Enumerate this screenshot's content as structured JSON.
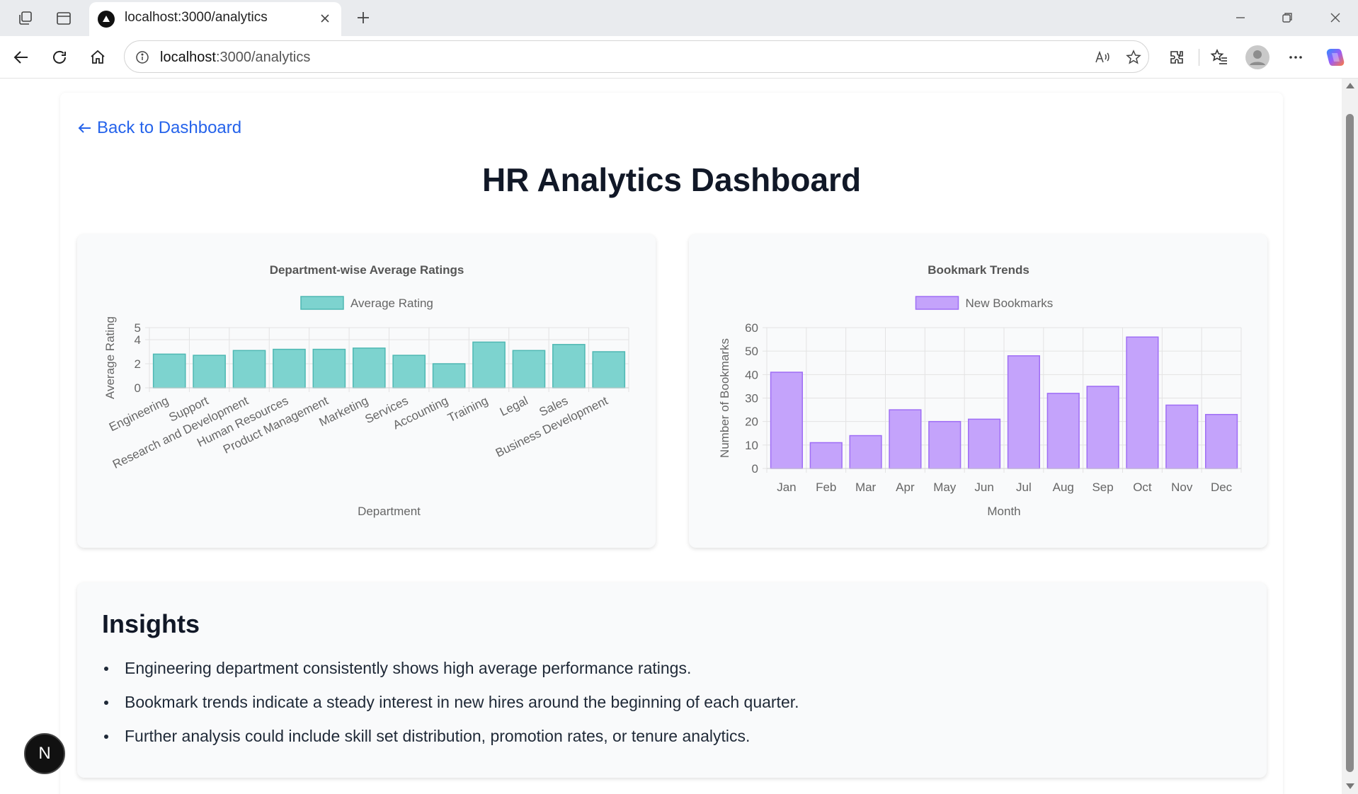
{
  "browser": {
    "tab_title": "localhost:3000/analytics",
    "url_host": "localhost",
    "url_path": ":3000/analytics"
  },
  "page": {
    "back_label": "Back to Dashboard",
    "title": "HR Analytics Dashboard"
  },
  "charts": {
    "ratings": {
      "type": "bar",
      "title": "Department-wise Average Ratings",
      "legend": "Average Rating",
      "xlabel": "Department",
      "ylabel": "Average Rating",
      "ylim": [
        0,
        5
      ],
      "yticks": [
        0,
        2,
        4,
        5
      ],
      "color": "#7dd3cf",
      "border": "#4fb8b3",
      "categories": [
        "Engineering",
        "Support",
        "Research and Development",
        "Human Resources",
        "Product Management",
        "Marketing",
        "Services",
        "Accounting",
        "Training",
        "Legal",
        "Sales",
        "Business Development"
      ],
      "values": [
        2.8,
        2.7,
        3.1,
        3.2,
        3.2,
        3.3,
        2.7,
        2.0,
        3.8,
        3.1,
        3.6,
        3.0
      ]
    },
    "bookmarks": {
      "type": "bar",
      "title": "Bookmark Trends",
      "legend": "New Bookmarks",
      "xlabel": "Month",
      "ylabel": "Number of Bookmarks",
      "ylim": [
        0,
        60
      ],
      "yticks": [
        0,
        10,
        20,
        30,
        40,
        50,
        60
      ],
      "color": "#c4a3fb",
      "border": "#9f6ef5",
      "categories": [
        "Jan",
        "Feb",
        "Mar",
        "Apr",
        "May",
        "Jun",
        "Jul",
        "Aug",
        "Sep",
        "Oct",
        "Nov",
        "Dec"
      ],
      "values": [
        41,
        11,
        14,
        25,
        20,
        21,
        48,
        32,
        35,
        56,
        27,
        23
      ]
    }
  },
  "insights": {
    "title": "Insights",
    "items": [
      "Engineering department consistently shows high average performance ratings.",
      "Bookmark trends indicate a steady interest in new hires around the beginning of each quarter.",
      "Further analysis could include skill set distribution, promotion rates, or tenure analytics."
    ]
  },
  "next_badge": "N",
  "chart_data": [
    {
      "type": "bar",
      "title": "Department-wise Average Ratings",
      "xlabel": "Department",
      "ylabel": "Average Rating",
      "ylim": [
        0,
        5
      ],
      "categories": [
        "Engineering",
        "Support",
        "Research and Development",
        "Human Resources",
        "Product Management",
        "Marketing",
        "Services",
        "Accounting",
        "Training",
        "Legal",
        "Sales",
        "Business Development"
      ],
      "series": [
        {
          "name": "Average Rating",
          "values": [
            2.8,
            2.7,
            3.1,
            3.2,
            3.2,
            3.3,
            2.7,
            2.0,
            3.8,
            3.1,
            3.6,
            3.0
          ]
        }
      ],
      "grid": true,
      "legend_position": "top"
    },
    {
      "type": "bar",
      "title": "Bookmark Trends",
      "xlabel": "Month",
      "ylabel": "Number of Bookmarks",
      "ylim": [
        0,
        60
      ],
      "categories": [
        "Jan",
        "Feb",
        "Mar",
        "Apr",
        "May",
        "Jun",
        "Jul",
        "Aug",
        "Sep",
        "Oct",
        "Nov",
        "Dec"
      ],
      "series": [
        {
          "name": "New Bookmarks",
          "values": [
            41,
            11,
            14,
            25,
            20,
            21,
            48,
            32,
            35,
            56,
            27,
            23
          ]
        }
      ],
      "grid": true,
      "legend_position": "top"
    }
  ]
}
